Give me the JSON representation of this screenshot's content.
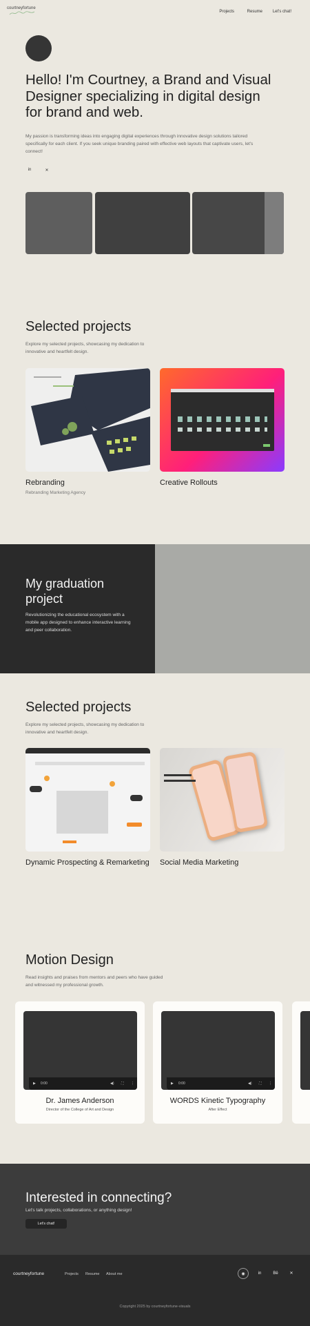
{
  "header": {
    "logo_text": "courtneyfortune",
    "nav": [
      "Projects",
      "Resume",
      "Let's chat!"
    ]
  },
  "hero": {
    "title": "Hello! I'm Courtney, a Brand and Visual Designer specializing in digital design for brand and web.",
    "description": "My passion is transforming ideas into engaging digital experiences through innovative design solutions tailored specifically for each client. If you seek unique branding paired with effective web layouts that captivate users, let's connect!",
    "social": [
      "in",
      "✕"
    ]
  },
  "selected1": {
    "title": "Selected projects",
    "description": "Explore my selected projects, showcasing my dedication to innovative and heartfelt design.",
    "cards": [
      {
        "title": "Rebranding",
        "subtitle": "Rebranding Marketing Agency"
      },
      {
        "title": "Creative Rollouts",
        "subtitle": ""
      }
    ]
  },
  "graduation": {
    "title": "My graduation project",
    "description": "Revolutionizing the educational ecosystem with a mobile app designed to enhance interactive learning and peer collaboration."
  },
  "selected2": {
    "title": "Selected projects",
    "description": "Explore my selected projects, showcasing my dedication to innovative and heartfelt design.",
    "cards": [
      {
        "title": "Dynamic Prospecting & Remarketing"
      },
      {
        "title": "Social Media Marketing"
      }
    ]
  },
  "motion": {
    "title": "Motion Design",
    "description": "Read insights and praises from mentors and peers who have guided and witnessed my professional growth.",
    "cards": [
      {
        "name": "Dr. James Anderson",
        "role": "Director of the College of Art and Design",
        "time": "0:00"
      },
      {
        "name": "WORDS Kinetic Typography",
        "role": "After Effect",
        "time": "0:00"
      }
    ]
  },
  "cta": {
    "title": "Interested in connecting?",
    "subtitle": "Let's talk projects, collaborations, or anything design!",
    "button": "Let's chat!"
  },
  "footer": {
    "logo_text": "courtneyfortune",
    "nav": [
      "Projects",
      "Resume",
      "About me"
    ],
    "social": [
      "◉",
      "in",
      "Bē",
      "✕"
    ],
    "copyright": "Copyright 2025 by courtneyfortune-visuals"
  },
  "colors": {
    "background": "#ebe8e0",
    "dark": "#2a2a2a",
    "accent_gradient": [
      "#ff6a2b",
      "#ff1f7a",
      "#8a3bff"
    ]
  }
}
